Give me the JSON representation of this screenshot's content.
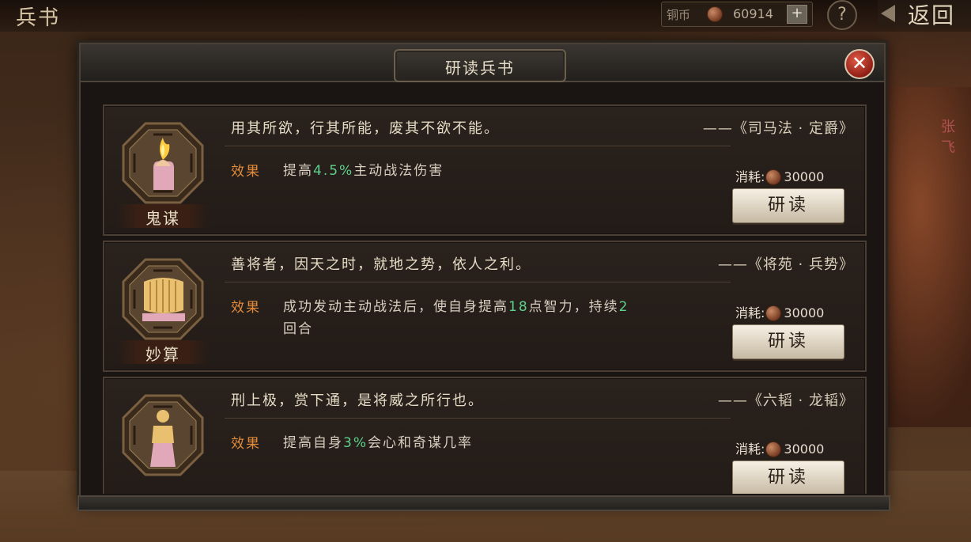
{
  "topbar": {
    "title": "兵书",
    "currency_label": "铜币",
    "currency_value": "60914",
    "plus": "+",
    "help": "?",
    "back": "返回"
  },
  "side_figure_name": "张\n飞",
  "dialog": {
    "title": "研读兵书",
    "close": "✕"
  },
  "books": [
    {
      "name": "鬼谋",
      "icon": "flame-hand-icon",
      "quote": "用其所欲，行其所能，废其不欲不能。",
      "source": "——《司马法 · 定爵》",
      "effect_label": "效果",
      "effect_pre": "提高",
      "effect_highlight": "4.5%",
      "effect_post": "主动战法伤害",
      "cost_label": "消耗:",
      "cost_value": "30000",
      "button": "研读"
    },
    {
      "name": "妙算",
      "icon": "scroll-icon",
      "quote": "善将者，因天之时，就地之势，依人之利。",
      "source": "——《将苑 · 兵势》",
      "effect_label": "效果",
      "effect_pre": "成功发动主动战法后，使自身提高",
      "effect_highlight": "18",
      "effect_post": "点智力，持续",
      "effect_highlight2": "2",
      "effect_post2": "回合",
      "cost_label": "消耗:",
      "cost_value": "30000",
      "button": "研读"
    },
    {
      "name": "",
      "icon": "general-statue-icon",
      "quote": "刑上极，赏下通，是将威之所行也。",
      "source": "——《六韬 · 龙韬》",
      "effect_label": "效果",
      "effect_pre": "提高自身",
      "effect_highlight": "3%",
      "effect_post": "会心和奇谋几率",
      "cost_label": "消耗:",
      "cost_value": "30000",
      "button": "研读"
    }
  ]
}
